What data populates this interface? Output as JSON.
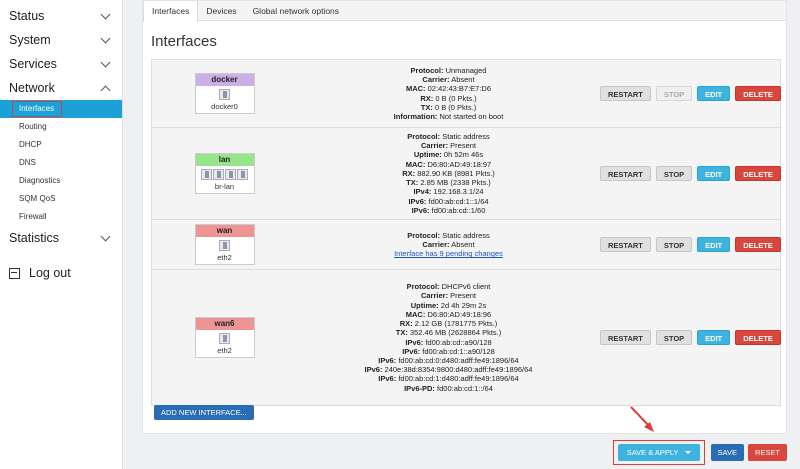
{
  "sidebar": {
    "status": "Status",
    "system": "System",
    "services": "Services",
    "network": "Network",
    "network_items": [
      "Interfaces",
      "Routing",
      "DHCP",
      "DNS",
      "Diagnostics",
      "SQM QoS",
      "Firewall"
    ],
    "statistics": "Statistics",
    "logout": "Log out"
  },
  "tabs": [
    "Interfaces",
    "Devices",
    "Global network options"
  ],
  "page_title": "Interfaces",
  "interfaces": [
    {
      "name": "docker",
      "color": "#cbb0e8",
      "device": "docker0",
      "lines": [
        [
          "Protocol:",
          "Unmanaged"
        ],
        [
          "Carrier:",
          "Absent"
        ],
        [
          "MAC:",
          "02:42:43:B7:E7:D6"
        ],
        [
          "RX:",
          "0 B (0 Pkts.)"
        ],
        [
          "TX:",
          "0 B (0 Pkts.)"
        ],
        [
          "Information:",
          "Not started on boot"
        ]
      ],
      "buttons": [
        "RESTART",
        "STOP",
        "EDIT",
        "DELETE"
      ]
    },
    {
      "name": "lan",
      "color": "#98e48c",
      "device": "br-lan",
      "lines": [
        [
          "Protocol:",
          "Static address"
        ],
        [
          "Carrier:",
          "Present"
        ],
        [
          "Uptime:",
          "0h 52m 46s"
        ],
        [
          "MAC:",
          "D6:80:AD:49:18:97"
        ],
        [
          "RX:",
          "882.90 KB (8981 Pkts.)"
        ],
        [
          "TX:",
          "2.85 MB (2338 Pkts.)"
        ],
        [
          "IPv4:",
          "192.168.3.1/24"
        ],
        [
          "IPv6:",
          "fd00:ab:cd:1::1/64"
        ],
        [
          "IPv6:",
          "fd00:ab:cd::1/60"
        ]
      ],
      "buttons": [
        "RESTART",
        "STOP",
        "EDIT",
        "DELETE"
      ]
    },
    {
      "name": "wan",
      "color": "#ee9494",
      "device": "eth2",
      "lines": [
        [
          "Protocol:",
          "Static address"
        ],
        [
          "Carrier:",
          "Absent"
        ]
      ],
      "pending": "Interface has 9 pending changes",
      "buttons": [
        "RESTART",
        "STOP",
        "EDIT",
        "DELETE"
      ]
    },
    {
      "name": "wan6",
      "color": "#ee9494",
      "device": "eth2",
      "lines": [
        [
          "Protocol:",
          "DHCPv6 client"
        ],
        [
          "Carrier:",
          "Present"
        ],
        [
          "Uptime:",
          "2d 4h 29m 2s"
        ],
        [
          "MAC:",
          "D6:80:AD:49:18:96"
        ],
        [
          "RX:",
          "2.12 GB (1781775 Pkts.)"
        ],
        [
          "TX:",
          "352.46 MB (2628864 Pkts.)"
        ],
        [
          "IPv6:",
          "fd00:ab:cd::a90/128"
        ],
        [
          "IPv6:",
          "fd00:ab:cd:1::a90/128"
        ],
        [
          "IPv6:",
          "fd00:ab:cd:0:d480:adff:fe49:1896/64"
        ],
        [
          "IPv6:",
          "240e:38d:8354:9800:d480:adff:fe49:1896/64"
        ],
        [
          "IPv6:",
          "fd00:ab:cd:1:d480:adff:fe49:1896/64"
        ],
        [
          "IPv6-PD:",
          "fd00:ab:cd:1::/64"
        ]
      ],
      "buttons": [
        "RESTART",
        "STOP",
        "EDIT",
        "DELETE"
      ]
    }
  ],
  "add_button": "ADD NEW INTERFACE...",
  "footer": {
    "save_apply": "SAVE & APPLY",
    "save": "SAVE",
    "reset": "RESET"
  },
  "colors": {
    "accent": "#1ba1d8",
    "primary": "#2b6db4",
    "danger": "#d9463d",
    "highlight": "#e03b3b"
  }
}
